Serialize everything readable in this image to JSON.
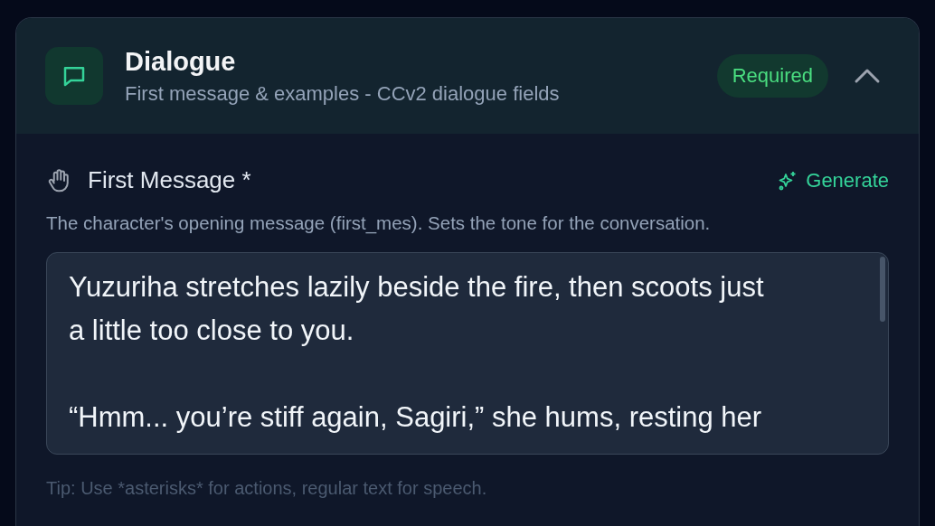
{
  "section": {
    "title": "Dialogue",
    "subtitle": "First message & examples - CCv2 dialogue fields",
    "badge": "Required",
    "expanded": true
  },
  "field": {
    "label": "First Message *",
    "action": "Generate",
    "description": "The character's opening message (first_mes). Sets the tone for the conversation.",
    "value": "Yuzuriha stretches lazily beside the fire, then scoots just a little too close to you.\n\n“Hmm... you’re stiff again, Sagiri,” she hums, resting her",
    "tip": "Tip: Use *asterisks* for actions, regular text for speech."
  }
}
